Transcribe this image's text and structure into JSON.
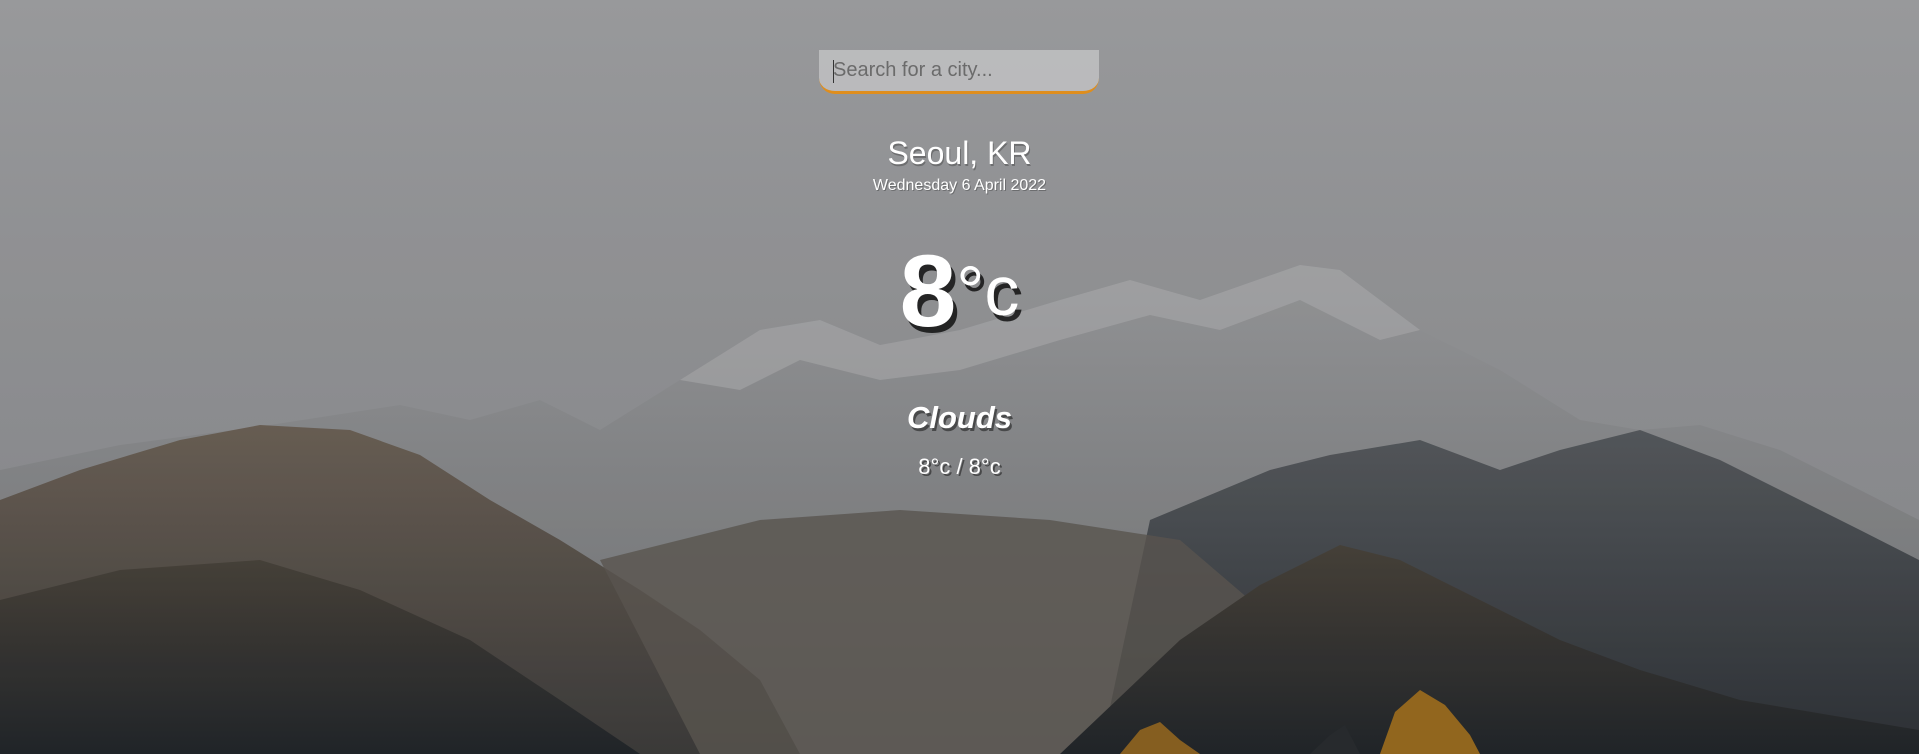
{
  "search": {
    "placeholder": "Search for a city...",
    "value": ""
  },
  "location": {
    "name": "Seoul, KR",
    "date": "Wednesday 6 April 2022"
  },
  "current": {
    "temp": "8",
    "unit": "°c",
    "condition": "Clouds",
    "hi_low": "8°c / 8°c"
  },
  "colors": {
    "accent": "#df8e1d",
    "text": "#ffffff"
  }
}
